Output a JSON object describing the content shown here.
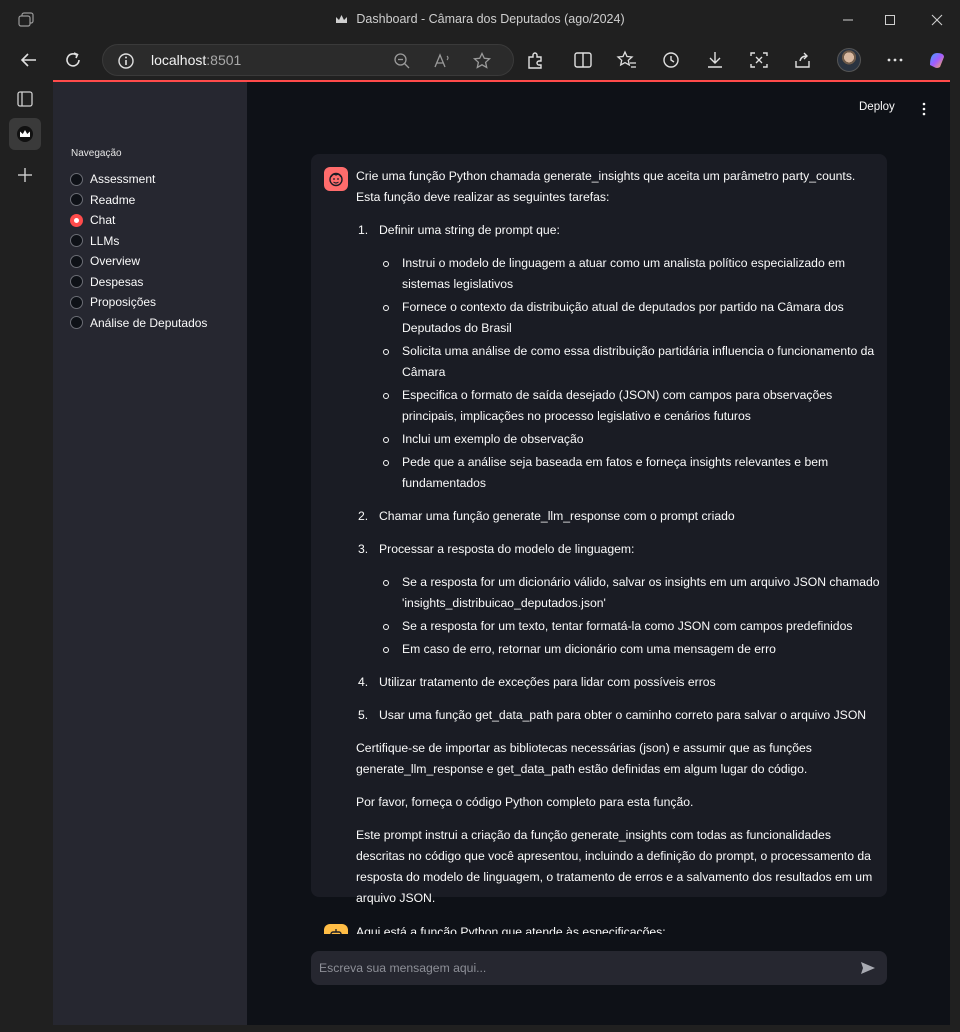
{
  "window": {
    "title": "Dashboard - Câmara dos Deputados (ago/2024)"
  },
  "browser": {
    "url_host": "localhost",
    "url_port": ":8501",
    "icons": [
      "back-icon",
      "refresh-icon",
      "info-icon",
      "zoom-out-icon",
      "read-aloud-icon",
      "favorite-star-icon",
      "extensions-icon",
      "split-screen-icon",
      "favorites-icon",
      "history-icon",
      "downloads-icon",
      "screenshot-icon",
      "share-icon",
      "avatar",
      "more-icon",
      "copilot-icon"
    ]
  },
  "app": {
    "deploy_label": "Deploy",
    "nav_title": "Navegação",
    "nav_items": [
      {
        "label": "Assessment",
        "selected": false
      },
      {
        "label": "Readme",
        "selected": false
      },
      {
        "label": "Chat",
        "selected": true
      },
      {
        "label": "LLMs",
        "selected": false
      },
      {
        "label": "Overview",
        "selected": false
      },
      {
        "label": "Despesas",
        "selected": false
      },
      {
        "label": "Proposições",
        "selected": false
      },
      {
        "label": "Análise de Deputados",
        "selected": false
      }
    ],
    "accent_color": "#ff4b4b"
  },
  "message": {
    "intro": "Crie uma função Python chamada generate_insights que aceita um parâmetro party_counts. Esta função deve realizar as seguintes tarefas:",
    "steps": [
      {
        "num": "1.",
        "text": "Definir uma string de prompt que:",
        "bullets": [
          "Instrui o modelo de linguagem a atuar como um analista político especializado em sistemas legislativos",
          "Fornece o contexto da distribuição atual de deputados por partido na Câmara dos Deputados do Brasil",
          "Solicita uma análise de como essa distribuição partidária influencia o funcionamento da Câmara",
          "Especifica o formato de saída desejado (JSON) com campos para observações principais, implicações no processo legislativo e cenários futuros",
          "Inclui um exemplo de observação",
          "Pede que a análise seja baseada em fatos e forneça insights relevantes e bem fundamentados"
        ]
      },
      {
        "num": "2.",
        "text": "Chamar uma função generate_llm_response com o prompt criado"
      },
      {
        "num": "3.",
        "text": "Processar a resposta do modelo de linguagem:",
        "bullets": [
          "Se a resposta for um dicionário válido, salvar os insights em um arquivo JSON chamado 'insights_distribuicao_deputados.json'",
          "Se a resposta for um texto, tentar formatá-la como JSON com campos predefinidos",
          "Em caso de erro, retornar um dicionário com uma mensagem de erro"
        ]
      },
      {
        "num": "4.",
        "text": "Utilizar tratamento de exceções para lidar com possíveis erros"
      },
      {
        "num": "5.",
        "text": "Usar uma função get_data_path para obter o caminho correto para salvar o arquivo JSON"
      }
    ],
    "para1": "Certifique-se de importar as bibliotecas necessárias (json) e assumir que as funções generate_llm_response e get_data_path estão definidas em algum lugar do código.",
    "para2": "Por favor, forneça o código Python completo para esta função.",
    "para3": "Este prompt instrui a criação da função generate_insights com todas as funcionalidades descritas no código que você apresentou, incluindo a definição do prompt, o processamento da resposta do modelo de linguagem, o tratamento de erros e a salvamento dos resultados em um arquivo JSON."
  },
  "assistant": {
    "preview": "Aqui está a função Python que atende às especificações:"
  },
  "chat_input": {
    "placeholder": "Escreva sua mensagem aqui..."
  }
}
